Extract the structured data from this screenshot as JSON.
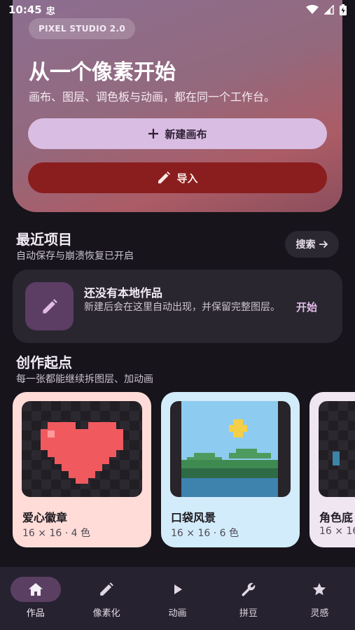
{
  "status": {
    "time": "10:45",
    "notif_glyph": "忠"
  },
  "hero": {
    "badge": "PIXEL STUDIO 2.0",
    "title": "从一个像素开始",
    "subtitle": "画布、图层、调色板与动画，都在同一个工作台。",
    "new_button": "新建画布",
    "import_button": "导入"
  },
  "recent": {
    "title": "最近项目",
    "subtitle": "自动保存与崩溃恢复已开启",
    "search_label": "搜索",
    "empty_title": "还没有本地作品",
    "empty_desc": "新建后会在这里自动出现，并保留完整图层。",
    "empty_action": "开始"
  },
  "starters": {
    "title": "创作起点",
    "subtitle": "每一张都能继续拆图层、加动画",
    "items": [
      {
        "name": "爱心徽章",
        "meta": "16 × 16 · 4 色",
        "bg": "#ffdcd8"
      },
      {
        "name": "口袋风景",
        "meta": "16 × 16 · 6 色",
        "bg": "#d3ecfb"
      },
      {
        "name": "角色底",
        "meta": "16 × 16",
        "bg": "#efe6f1"
      }
    ]
  },
  "nav": {
    "items": [
      {
        "label": "作品",
        "icon": "home-icon"
      },
      {
        "label": "像素化",
        "icon": "pencil-icon"
      },
      {
        "label": "动画",
        "icon": "play-icon"
      },
      {
        "label": "拼豆",
        "icon": "wrench-icon"
      },
      {
        "label": "灵感",
        "icon": "star-icon"
      }
    ]
  },
  "colors": {
    "background": "#17141b",
    "primary_button": "#d9bde2",
    "import_button": "#8a1e1e",
    "accent": "#e2bce6",
    "nav_active": "#5a3f63"
  }
}
